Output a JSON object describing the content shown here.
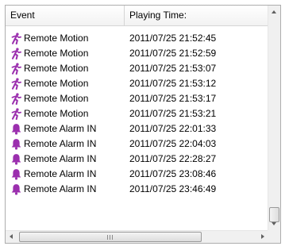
{
  "columns": {
    "event": "Event",
    "time": "Playing Time:"
  },
  "colors": {
    "event_icon": "#9b2fae"
  },
  "rows": [
    {
      "icon": "motion-icon",
      "event": "Remote Motion",
      "time": "2011/07/25 21:52:45"
    },
    {
      "icon": "motion-icon",
      "event": "Remote Motion",
      "time": "2011/07/25 21:52:59"
    },
    {
      "icon": "motion-icon",
      "event": "Remote Motion",
      "time": "2011/07/25 21:53:07"
    },
    {
      "icon": "motion-icon",
      "event": "Remote Motion",
      "time": "2011/07/25 21:53:12"
    },
    {
      "icon": "motion-icon",
      "event": "Remote Motion",
      "time": "2011/07/25 21:53:17"
    },
    {
      "icon": "motion-icon",
      "event": "Remote Motion",
      "time": "2011/07/25 21:53:21"
    },
    {
      "icon": "alarm-bell-icon",
      "event": "Remote Alarm IN",
      "time": "2011/07/25 22:01:33"
    },
    {
      "icon": "alarm-bell-icon",
      "event": "Remote Alarm IN",
      "time": "2011/07/25 22:04:03"
    },
    {
      "icon": "alarm-bell-icon",
      "event": "Remote Alarm IN",
      "time": "2011/07/25 22:28:27"
    },
    {
      "icon": "alarm-bell-icon",
      "event": "Remote Alarm IN",
      "time": "2011/07/25 23:08:46"
    },
    {
      "icon": "alarm-bell-icon",
      "event": "Remote Alarm IN",
      "time": "2011/07/25 23:46:49"
    }
  ]
}
